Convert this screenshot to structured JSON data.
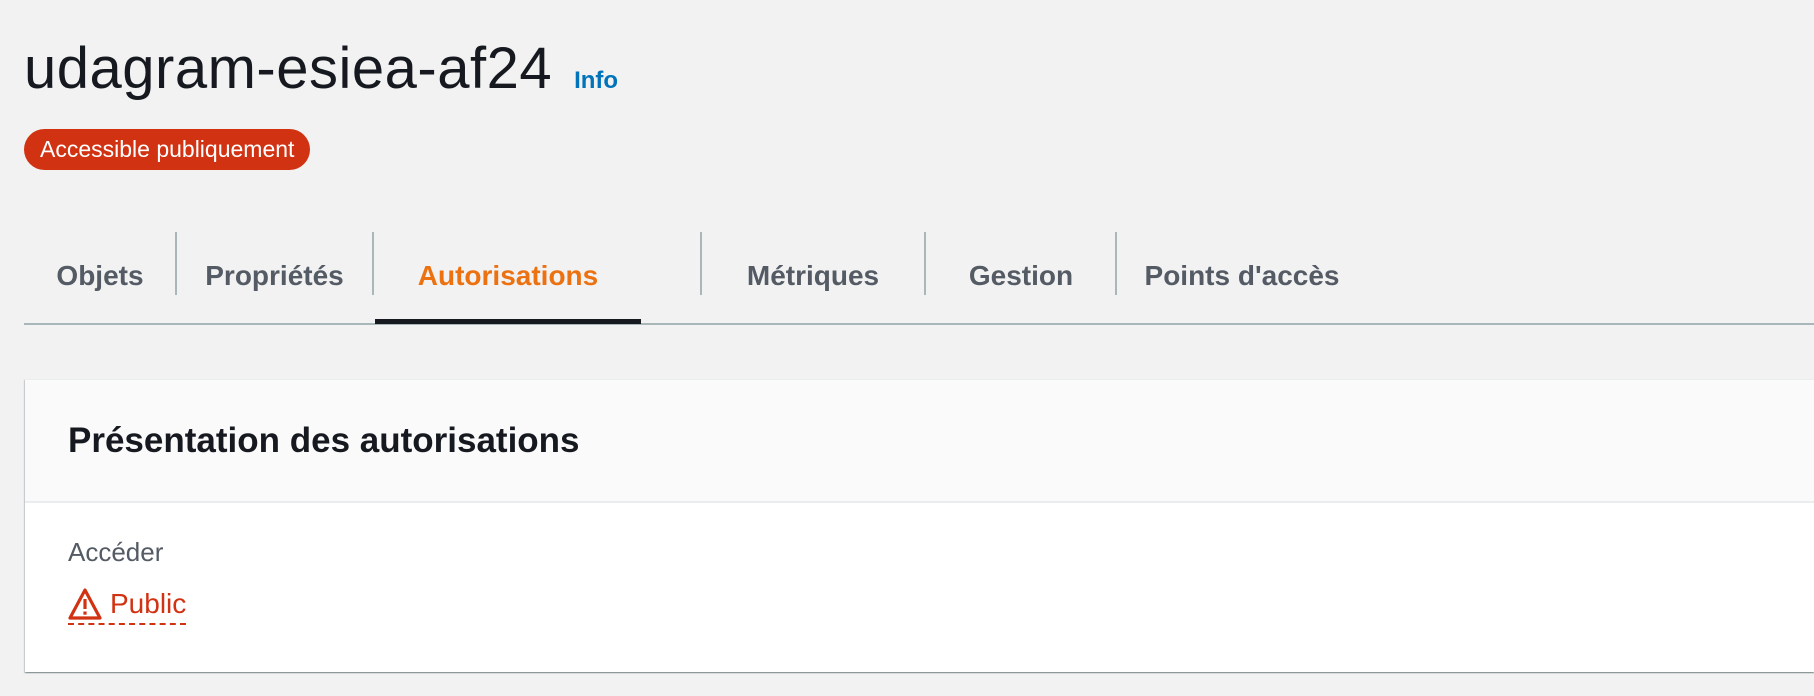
{
  "header": {
    "title": "udagram-esiea-af24",
    "info_link": "Info",
    "badge": "Accessible publiquement"
  },
  "tabs": [
    {
      "label": "Objets",
      "active": false
    },
    {
      "label": "Propriétés",
      "active": false
    },
    {
      "label": "Autorisations",
      "active": true
    },
    {
      "label": "Métriques",
      "active": false
    },
    {
      "label": "Gestion",
      "active": false
    },
    {
      "label": "Points d'accès",
      "active": false
    }
  ],
  "panel": {
    "title": "Présentation des autorisations",
    "field_label": "Accéder",
    "access_value": "Public",
    "access_icon": "warning-icon"
  },
  "colors": {
    "accent_orange": "#ec7211",
    "danger_red": "#d13212",
    "link_blue": "#0073bb",
    "text_dark": "#16191f",
    "text_grey": "#545b64"
  }
}
